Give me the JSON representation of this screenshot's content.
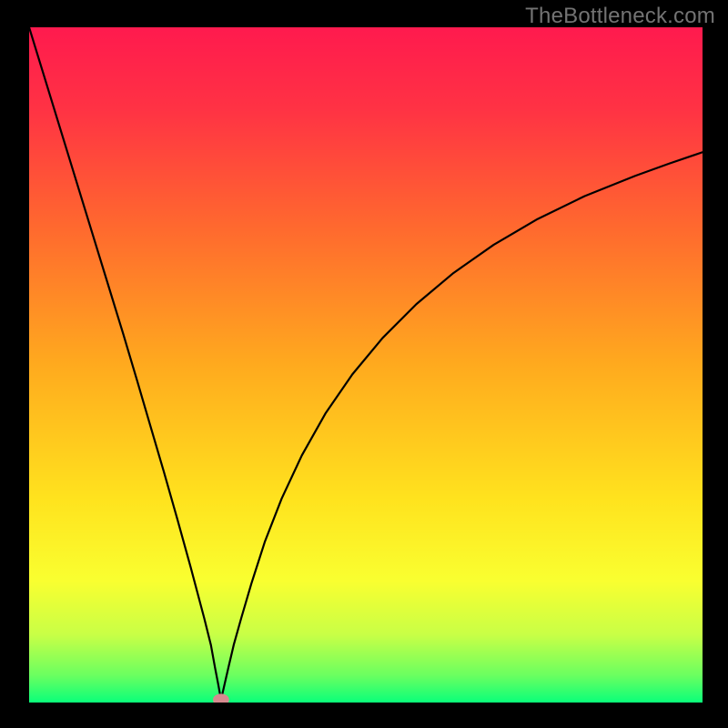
{
  "watermark": "TheBottleneck.com",
  "chart_data": {
    "type": "line",
    "title": "",
    "xlabel": "",
    "ylabel": "",
    "xlim": [
      0,
      100
    ],
    "ylim": [
      0,
      100
    ],
    "grid": false,
    "legend": false,
    "background_gradient_stops": [
      {
        "offset": 0.0,
        "color": "#ff1a4e"
      },
      {
        "offset": 0.12,
        "color": "#ff3244"
      },
      {
        "offset": 0.3,
        "color": "#ff6a2e"
      },
      {
        "offset": 0.5,
        "color": "#ffaa1e"
      },
      {
        "offset": 0.7,
        "color": "#ffe31e"
      },
      {
        "offset": 0.82,
        "color": "#f9ff30"
      },
      {
        "offset": 0.9,
        "color": "#c8ff46"
      },
      {
        "offset": 0.96,
        "color": "#6aff60"
      },
      {
        "offset": 1.0,
        "color": "#0aff7a"
      }
    ],
    "series": [
      {
        "name": "left-branch",
        "color": "#000000",
        "width": 2.2,
        "x": [
          0,
          2,
          4,
          6,
          8,
          10,
          12,
          14,
          16,
          18,
          20,
          22,
          24,
          26,
          27,
          27.6,
          28.1,
          28.5
        ],
        "y": [
          100,
          93.5,
          87,
          80.5,
          74,
          67.5,
          61,
          54.5,
          47.8,
          41,
          34.2,
          27.2,
          20,
          12.5,
          8.5,
          5.2,
          2.6,
          0.4
        ]
      },
      {
        "name": "right-branch",
        "color": "#000000",
        "width": 2.2,
        "x": [
          28.5,
          29.0,
          29.6,
          30.4,
          31.5,
          33,
          35,
          37.5,
          40.5,
          44,
          48,
          52.5,
          57.5,
          63,
          69,
          75.5,
          82.5,
          90,
          95,
          100
        ],
        "y": [
          0.4,
          2.6,
          5.2,
          8.6,
          12.5,
          17.6,
          23.8,
          30.2,
          36.6,
          42.8,
          48.6,
          54.0,
          59.0,
          63.6,
          67.8,
          71.6,
          75.0,
          78.0,
          79.8,
          81.5
        ]
      }
    ],
    "marker": {
      "name": "min-marker",
      "x": 28.5,
      "y": 0.4,
      "rx": 1.2,
      "ry": 0.9,
      "color": "#d68a8f"
    }
  }
}
